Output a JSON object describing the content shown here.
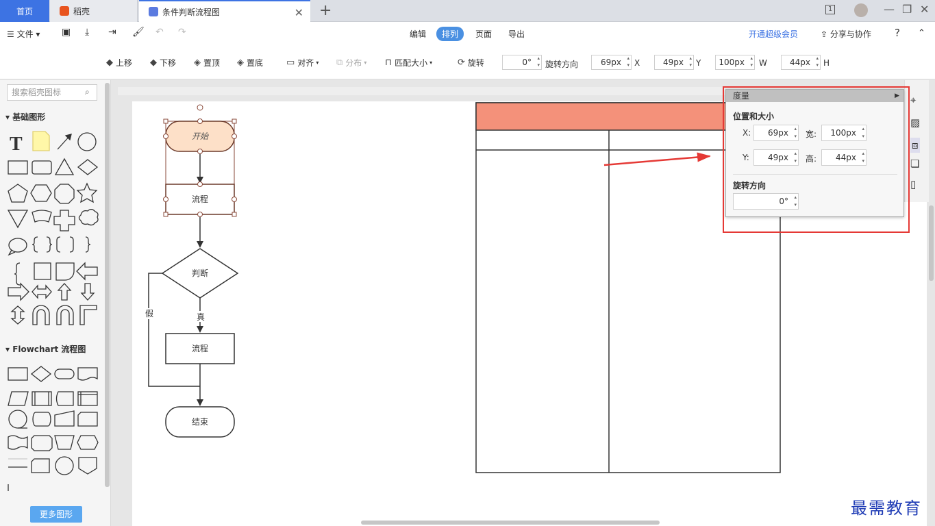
{
  "tabs": {
    "home": "首页",
    "app": "稻壳",
    "doc": "条件判断流程图"
  },
  "window": {
    "page_indicator": "1"
  },
  "menu": {
    "file": "文件",
    "tabs": [
      "编辑",
      "排列",
      "页面",
      "导出"
    ],
    "active_tab": "排列",
    "vip": "开通超级会员",
    "share": "分享与协作",
    "help": "?"
  },
  "toolbar": {
    "move_up": "上移",
    "move_down": "下移",
    "to_top": "置顶",
    "to_bottom": "置底",
    "align": "对齐",
    "distribute": "分布",
    "match_size": "匹配大小",
    "rotate": "旋转",
    "angle": "0°",
    "rotate_dir": "旋转方向",
    "x_value": "69px",
    "x_label": "X",
    "y_value": "49px",
    "y_label": "Y",
    "w_value": "100px",
    "w_label": "W",
    "h_value": "44px",
    "h_label": "H"
  },
  "sidebar": {
    "search_placeholder": "搜索稻壳图标",
    "basic_title": "基础图形",
    "flowchart_title": "Flowchart 流程图",
    "more_button": "更多图形"
  },
  "flowchart": {
    "start": "开始",
    "process1": "流程",
    "decision": "判断",
    "true_label": "真",
    "false_label": "假",
    "process2": "流程",
    "end": "结束"
  },
  "measure_panel": {
    "title": "度量",
    "pos_size_title": "位置和大小",
    "x_label": "X:",
    "x_value": "69px",
    "w_label": "宽:",
    "w_value": "100px",
    "y_label": "Y:",
    "y_value": "49px",
    "h_label": "高:",
    "h_value": "44px",
    "rotate_title": "旋转方向",
    "rotate_value": "0°"
  },
  "watermark": "最需教育",
  "colors": {
    "accent": "#3d73e3",
    "table_header": "#f4917a",
    "start_fill": "#fde0c8",
    "annotation": "#e53935"
  }
}
